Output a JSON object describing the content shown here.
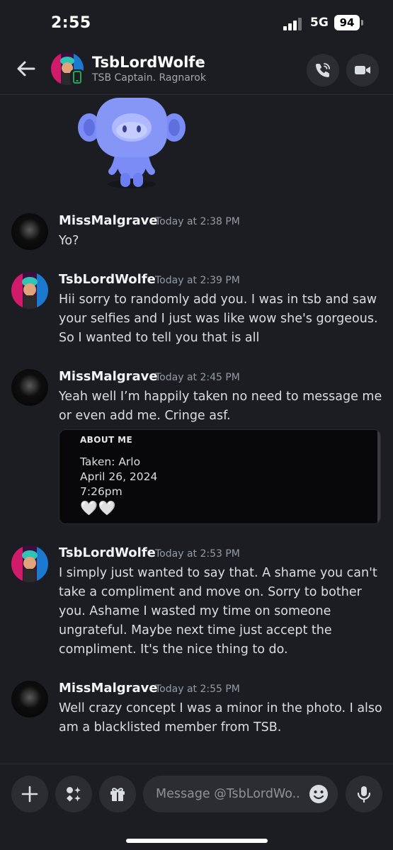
{
  "status_bar": {
    "time": "2:55",
    "network": "5G",
    "battery": "94"
  },
  "header": {
    "name": "TsbLordWolfe",
    "chevron": "›",
    "subtitle": "TSB Captain. Ragnarok",
    "icons": [
      "back-arrow-icon",
      "phone-icon",
      "video-camera-icon"
    ]
  },
  "messages": [
    {
      "author": "MissMalgrave",
      "time": "Today at 2:38 PM",
      "lines": [
        "Yo?"
      ]
    },
    {
      "author": "TsbLordWolfe",
      "time": "Today at 2:39 PM",
      "lines": [
        "Hii sorry to randomly add you. I was in tsb and saw",
        "your selfies and I just was like wow she's gorgeous.",
        "So I wanted to tell you that is all"
      ]
    },
    {
      "author": "MissMalgrave",
      "time": "Today at 2:45 PM",
      "lines": [
        "Yeah well I’m happily taken no need to message me",
        "or even add me. Cringe asf."
      ]
    },
    {
      "author": "TsbLordWolfe",
      "time": "Today at 2:53 PM",
      "lines": [
        "I simply just wanted to say that. A shame you can't",
        "take a compliment and move on. Sorry to bother",
        "you. Ashame I wasted my time on someone",
        "ungrateful. Maybe next time just accept the",
        "compliment. It's the nice thing to do."
      ]
    },
    {
      "author": "MissMalgrave",
      "time": "Today at 2:55 PM",
      "lines": [
        "Well crazy concept I was a minor in the photo. I also",
        "am a blacklisted member from TSB."
      ]
    }
  ],
  "embed": {
    "title": "ABOUT ME",
    "lines": [
      "Taken: Arlo",
      "April 26, 2024",
      "7:26pm"
    ],
    "hearts": "🤍🤍"
  },
  "composer": {
    "placeholder": "Message @TsbLordWo..",
    "icons": [
      "plus-icon",
      "apps-icon",
      "gift-icon",
      "emoji-icon",
      "microphone-icon"
    ]
  },
  "colors": {
    "background": "#1c1d22",
    "surface": "#2b2d33",
    "wumpus": "#7a8cf5"
  }
}
